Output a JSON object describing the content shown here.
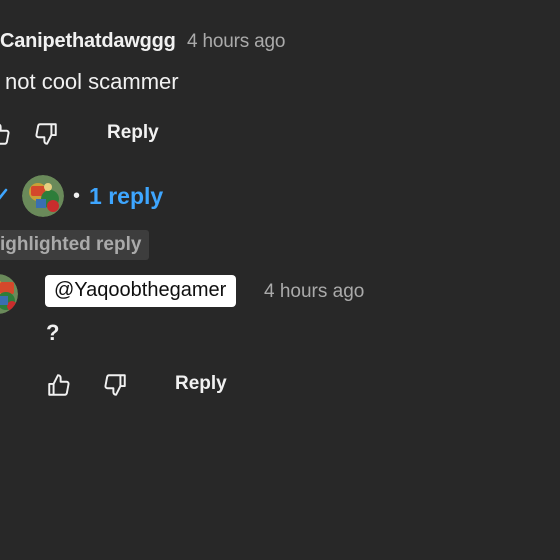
{
  "comment": {
    "author": "Canipethatdawggg",
    "timestamp": "4 hours ago",
    "text": "not cool scammer",
    "reply_label": "Reply"
  },
  "replies_toggle": {
    "separator": "•",
    "count_label": "1 reply"
  },
  "reply": {
    "badge": "ighlighted reply",
    "mention": "@Yaqoobthegamer",
    "timestamp": "4 hours ago",
    "text": "?",
    "reply_label": "Reply"
  },
  "icons": {
    "like": "thumbs-up-icon",
    "dislike": "thumbs-down-icon",
    "expand": "chevron-down-icon"
  },
  "colors": {
    "background": "#282828",
    "text": "#f1f1f1",
    "muted": "#aaaaaa",
    "link": "#3ea6ff",
    "badge_bg": "#3d3d3d",
    "chip_bg": "#ffffff"
  }
}
